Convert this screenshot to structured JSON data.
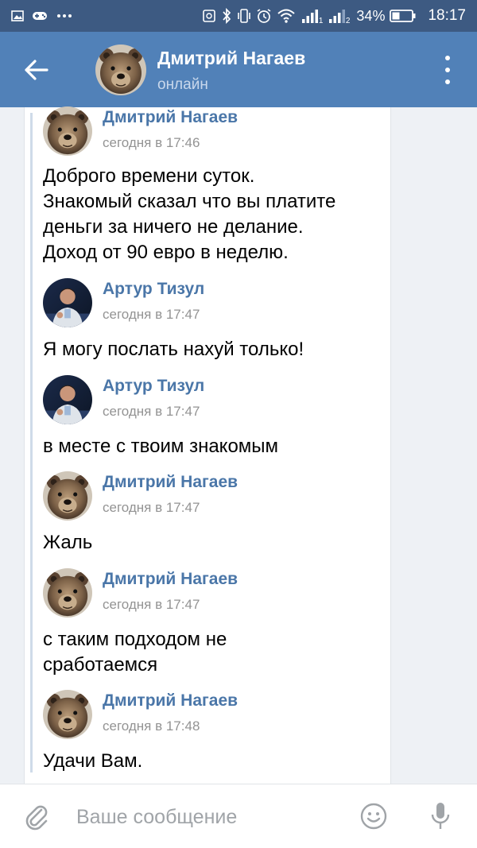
{
  "status_bar": {
    "battery_percent": "34%",
    "time": "18:17",
    "icons": [
      "image-icon",
      "gamepad-icon",
      "more-notifications-icon",
      "nfc-icon",
      "bluetooth-icon",
      "vibrate-icon",
      "alarm-icon",
      "wifi-icon",
      "signal-1-icon",
      "signal-2-icon",
      "battery-icon"
    ],
    "sim1_label": "1",
    "sim2_label": "2"
  },
  "header": {
    "name": "Дмитрий Нагаев",
    "status": "онлайн"
  },
  "messages": [
    {
      "author": "Дмитрий Нагаев",
      "time": "сегодня в 17:46",
      "text": "Доброго времени суток.\nЗнакомый сказал что вы платите\nденьги за ничего не делание.\nДоход от 90 евро в неделю.",
      "avatar": "bear"
    },
    {
      "author": "Артур Тизул",
      "time": "сегодня в 17:47",
      "text": "Я могу послать нахуй только!",
      "avatar": "person"
    },
    {
      "author": "Артур Тизул",
      "time": "сегодня в 17:47",
      "text": "в месте с твоим знакомым",
      "avatar": "person"
    },
    {
      "author": "Дмитрий Нагаев",
      "time": "сегодня в 17:47",
      "text": "Жаль",
      "avatar": "bear"
    },
    {
      "author": "Дмитрий Нагаев",
      "time": "сегодня в 17:47",
      "text": "с таким подходом не\nсработаемся",
      "avatar": "bear"
    },
    {
      "author": "Дмитрий Нагаев",
      "time": "сегодня в 17:48",
      "text": "Удачи Вам.",
      "avatar": "bear"
    }
  ],
  "composer": {
    "placeholder": "Ваше сообщение"
  },
  "colors": {
    "status_bar": "#3d5a82",
    "header": "#5181b8",
    "author_link": "#4a76a8",
    "timestamp": "#939393"
  }
}
